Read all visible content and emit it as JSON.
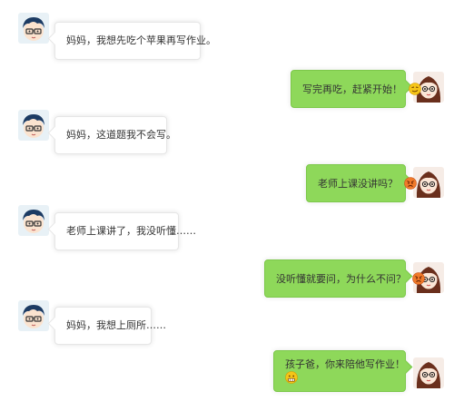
{
  "colors": {
    "left_bubble": "#ffffff",
    "right_bubble": "#8ed85a",
    "background": "#ffffff"
  },
  "messages": [
    {
      "side": "left",
      "sender": "child",
      "text": "妈妈，我想先吃个苹果再写作业。"
    },
    {
      "side": "right",
      "sender": "mother",
      "text": "写完再吃，赶紧开始！",
      "emoji": "smirk-face-icon"
    },
    {
      "side": "left",
      "sender": "child",
      "text": "妈妈，这道题我不会写。"
    },
    {
      "side": "right",
      "sender": "mother",
      "text": "老师上课没讲吗？",
      "emoji": "angry-face-icon"
    },
    {
      "side": "left",
      "sender": "child",
      "text": "老师上课讲了，我没听懂……"
    },
    {
      "side": "right",
      "sender": "mother",
      "text": "没听懂就要问，为什么不问？",
      "emoji": "angry-face-icon"
    },
    {
      "side": "left",
      "sender": "child",
      "text": "妈妈，我想上厕所……"
    },
    {
      "side": "right",
      "sender": "mother",
      "text": "孩子爸，你来陪他写作业！",
      "emoji": "grimace-face-icon"
    }
  ]
}
